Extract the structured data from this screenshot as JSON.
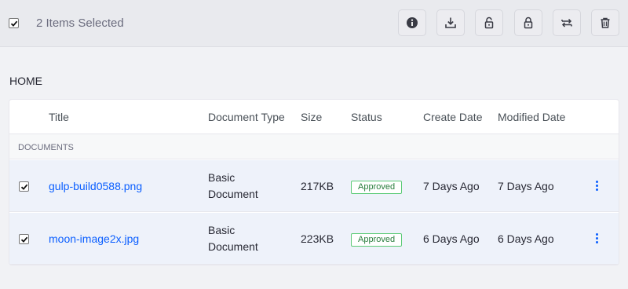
{
  "toolbar": {
    "selected_text": "2 Items Selected",
    "actions": [
      {
        "name": "info",
        "icon": "info-icon"
      },
      {
        "name": "download",
        "icon": "download-icon"
      },
      {
        "name": "checkin",
        "icon": "unlock-icon"
      },
      {
        "name": "checkout",
        "icon": "lock-icon"
      },
      {
        "name": "move",
        "icon": "move-icon"
      },
      {
        "name": "delete",
        "icon": "trash-icon"
      }
    ]
  },
  "section": {
    "title": "HOME"
  },
  "table": {
    "columns": [
      "Title",
      "Document Type",
      "Size",
      "Status",
      "Create Date",
      "Modified Date"
    ],
    "group_label": "DOCUMENTS",
    "rows": [
      {
        "title": "gulp-build0588.png",
        "document_type": "Basic Document",
        "size": "217KB",
        "status": "Approved",
        "create_date": "7 Days Ago",
        "modified_date": "7 Days Ago",
        "checked": true
      },
      {
        "title": "moon-image2x.jpg",
        "document_type": "Basic Document",
        "size": "223KB",
        "status": "Approved",
        "create_date": "6 Days Ago",
        "modified_date": "6 Days Ago",
        "checked": true
      }
    ]
  },
  "colors": {
    "accent": "#0b5fff",
    "status_approved": "#287d3c",
    "selected_row": "#eef2fa"
  }
}
